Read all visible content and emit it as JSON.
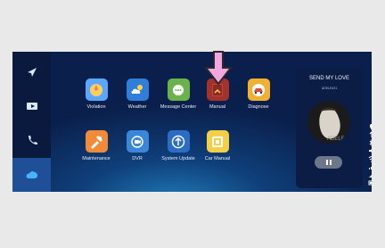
{
  "apps": [
    {
      "label": "Violation",
      "icon": "violation-icon",
      "color": "#62a9ff"
    },
    {
      "label": "Weather",
      "icon": "weather-icon",
      "color": "#2f7ed9"
    },
    {
      "label": "Message Center",
      "icon": "message-center-icon",
      "color": "#69b34a"
    },
    {
      "label": "Manual",
      "icon": "manual-icon",
      "color": "#a3322d"
    },
    {
      "label": "Diagnose",
      "icon": "diagnose-icon",
      "color": "#f0b132"
    },
    {
      "label": "Maintenance",
      "icon": "maintenance-icon",
      "color": "#f18b3a"
    },
    {
      "label": "DVR",
      "icon": "dvr-icon",
      "color": "#3a86d8"
    },
    {
      "label": "System Update",
      "icon": "system-update-icon",
      "color": "#2a6cc6"
    },
    {
      "label": "Car Manual",
      "icon": "car-manual-icon",
      "color": "#f2cf45"
    }
  ],
  "sidebar": {
    "items": [
      {
        "name": "navigation-icon"
      },
      {
        "name": "media-icon"
      },
      {
        "name": "phone-icon"
      },
      {
        "name": "cloud-icon",
        "active": true
      }
    ]
  },
  "music": {
    "title": "SEND MY LOVE",
    "artist": "ADELE421",
    "album_text": "ADELE"
  }
}
